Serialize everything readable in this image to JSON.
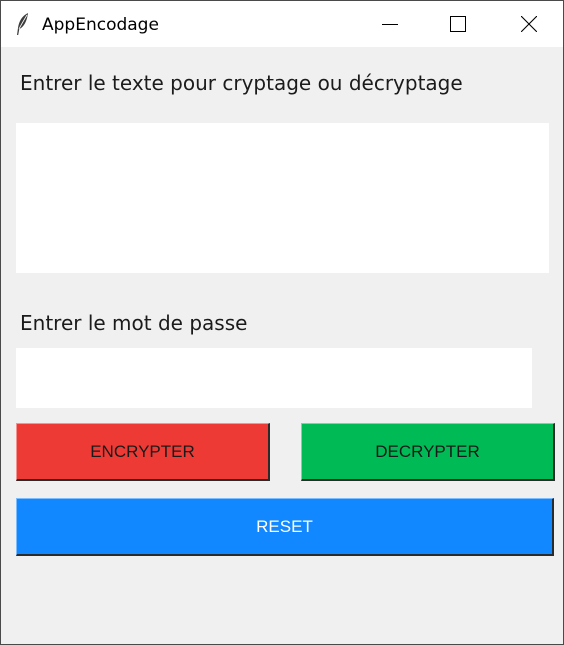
{
  "window": {
    "title": "AppEncodage",
    "icon": "feather-icon",
    "controls": {
      "minimize_icon": "minimize-icon",
      "maximize_icon": "maximize-icon",
      "close_icon": "close-icon"
    }
  },
  "form": {
    "text_label": "Entrer le texte pour cryptage ou décryptage",
    "text_value": "",
    "password_label": "Entrer le mot de passe",
    "password_value": ""
  },
  "buttons": {
    "encrypt_label": "ENCRYPTER",
    "decrypt_label": "DECRYPTER",
    "reset_label": "RESET"
  },
  "colors": {
    "window_background": "#f0f0f0",
    "encrypt_button": "#ee3a35",
    "decrypt_button": "#00bb55",
    "reset_button": "#1188ff",
    "reset_text": "#ffffff"
  }
}
